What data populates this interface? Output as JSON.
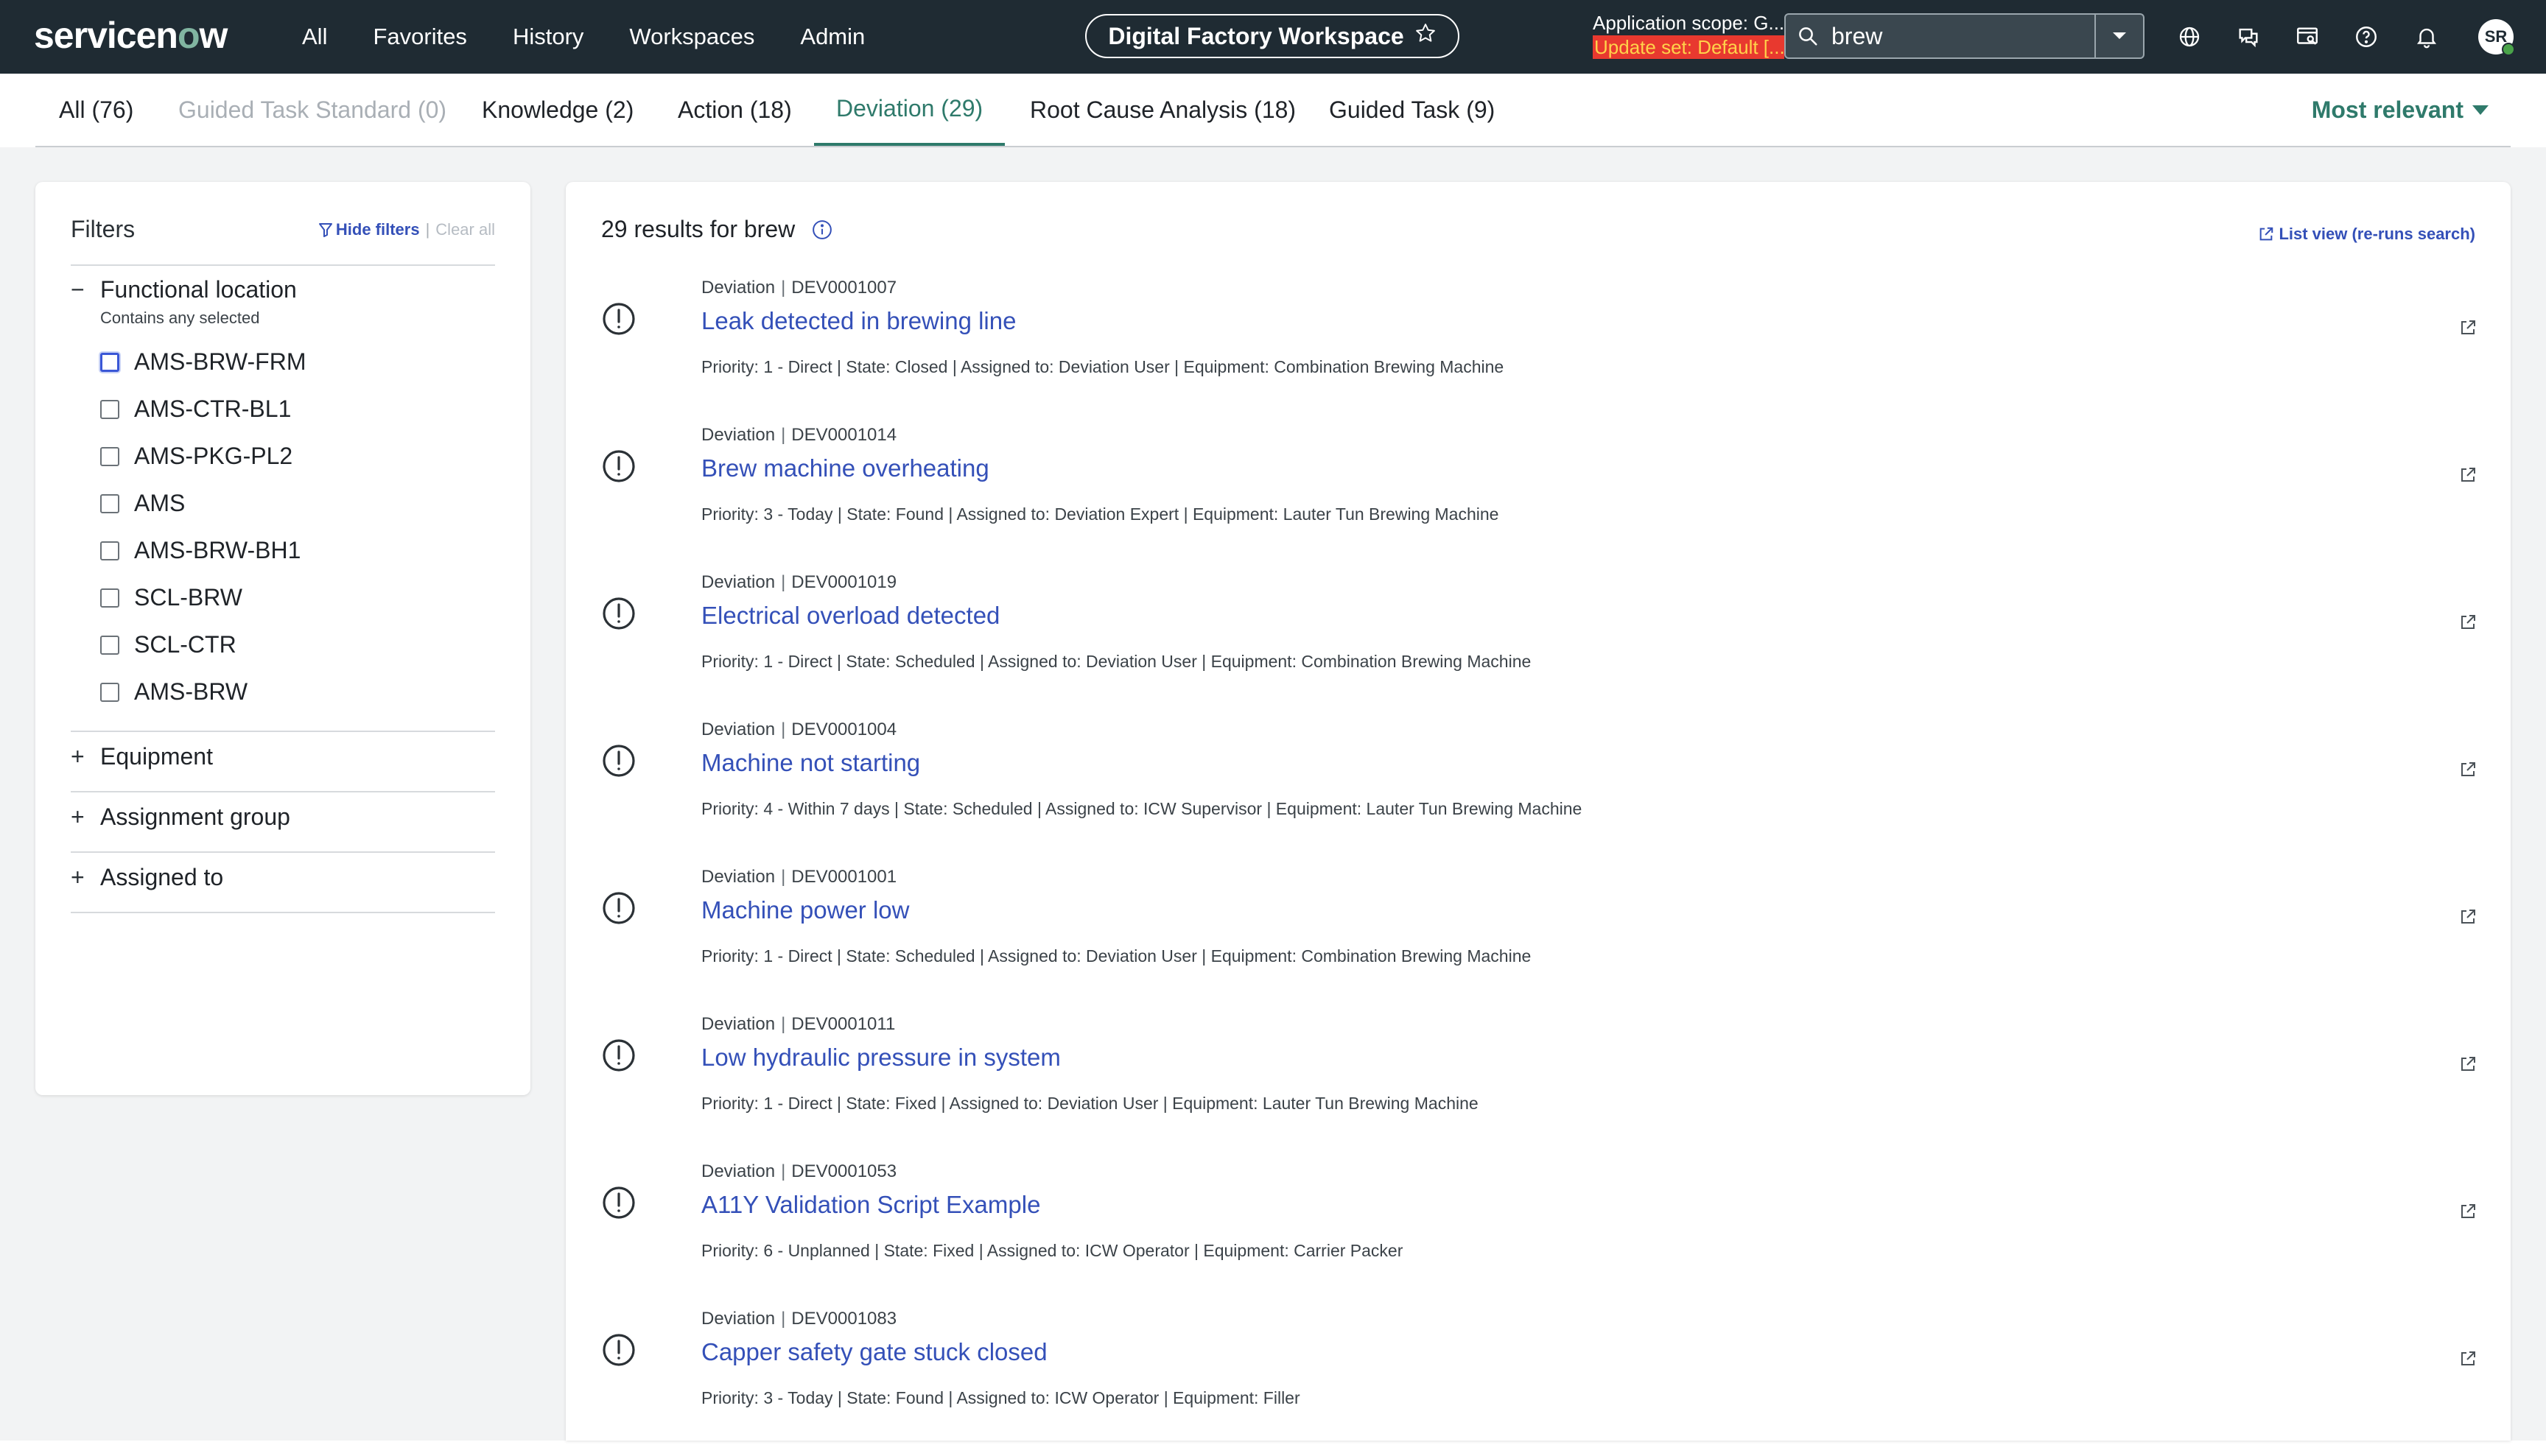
{
  "topbar": {
    "logo_pre": "servicen",
    "logo_o": "o",
    "logo_post": "w",
    "nav": [
      "All",
      "Favorites",
      "History",
      "Workspaces",
      "Admin"
    ],
    "workspace": "Digital Factory Workspace",
    "scope_line1": "Application scope: G...",
    "scope_line2": "Update set: Default [...",
    "search_value": "brew",
    "avatar_initials": "SR",
    "icons": [
      "globe-icon",
      "chat-icon",
      "preview-icon",
      "help-icon",
      "bell-icon"
    ]
  },
  "tabs": [
    {
      "label": "All (76)"
    },
    {
      "label": "Guided Task Standard (0)"
    },
    {
      "label": "Knowledge (2)"
    },
    {
      "label": "Action (18)"
    },
    {
      "label": "Deviation (29)"
    },
    {
      "label": "Root Cause Analysis (18)"
    },
    {
      "label": "Guided Task (9)"
    }
  ],
  "sort_label": "Most relevant",
  "filters": {
    "title": "Filters",
    "hide_label": "Hide filters",
    "sep": "|",
    "clear_label": "Clear all",
    "functional_location": {
      "title": "Functional location",
      "subtitle": "Contains any selected",
      "toggle": "−",
      "options": [
        "AMS-BRW-FRM",
        "AMS-CTR-BL1",
        "AMS-PKG-PL2",
        "AMS",
        "AMS-BRW-BH1",
        "SCL-BRW",
        "SCL-CTR",
        "AMS-BRW"
      ]
    },
    "groups": [
      {
        "toggle": "+",
        "title": "Equipment"
      },
      {
        "toggle": "+",
        "title": "Assignment group"
      },
      {
        "toggle": "+",
        "title": "Assigned to"
      }
    ]
  },
  "results": {
    "summary": "29 results for brew",
    "list_view_label": "List view (re-runs search)",
    "items": [
      {
        "type": "Deviation",
        "number": "DEV0001007",
        "title": "Leak detected in brewing line",
        "details": "Priority: 1 - Direct | State: Closed | Assigned to: Deviation User | Equipment: Combination Brewing Machine"
      },
      {
        "type": "Deviation",
        "number": "DEV0001014",
        "title": "Brew machine overheating",
        "details": "Priority: 3 - Today | State: Found | Assigned to: Deviation Expert | Equipment: Lauter Tun Brewing Machine"
      },
      {
        "type": "Deviation",
        "number": "DEV0001019",
        "title": "Electrical overload detected",
        "details": "Priority: 1 - Direct | State: Scheduled | Assigned to: Deviation User | Equipment: Combination Brewing Machine"
      },
      {
        "type": "Deviation",
        "number": "DEV0001004",
        "title": "Machine not starting",
        "details": "Priority: 4 - Within 7 days | State: Scheduled | Assigned to: ICW Supervisor | Equipment: Lauter Tun Brewing Machine"
      },
      {
        "type": "Deviation",
        "number": "DEV0001001",
        "title": "Machine power low",
        "details": "Priority: 1 - Direct | State: Scheduled | Assigned to: Deviation User | Equipment: Combination Brewing Machine"
      },
      {
        "type": "Deviation",
        "number": "DEV0001011",
        "title": "Low hydraulic pressure in system",
        "details": "Priority: 1 - Direct | State: Fixed | Assigned to: Deviation User | Equipment: Lauter Tun Brewing Machine"
      },
      {
        "type": "Deviation",
        "number": "DEV0001053",
        "title": "A11Y Validation Script Example",
        "details": "Priority: 6 - Unplanned | State: Fixed | Assigned to: ICW Operator | Equipment: Carrier Packer"
      },
      {
        "type": "Deviation",
        "number": "DEV0001083",
        "title": "Capper safety gate stuck closed",
        "details": "Priority: 3 - Today | State: Found | Assigned to: ICW Operator | Equipment: Filler"
      }
    ]
  }
}
